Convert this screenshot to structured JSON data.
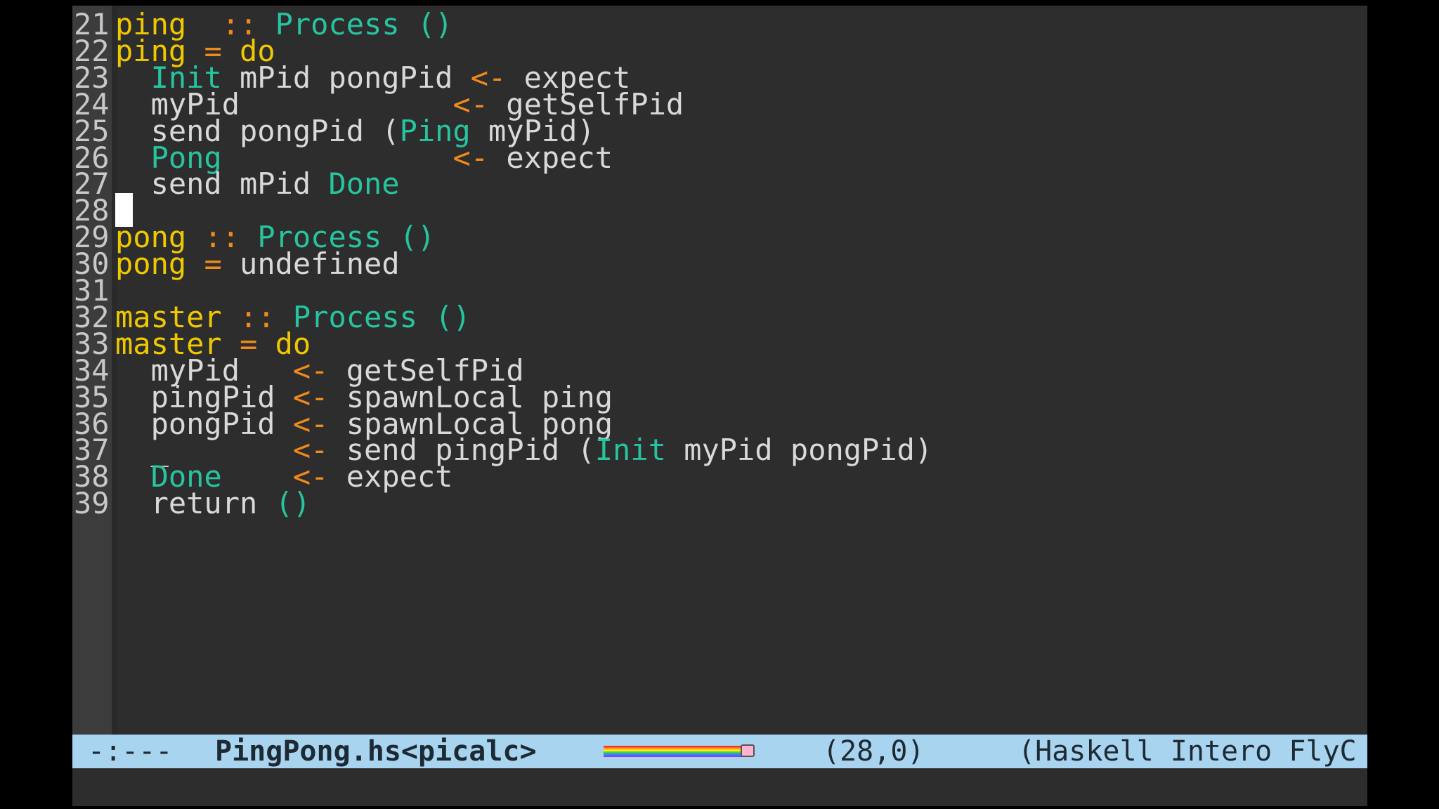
{
  "editor": {
    "lines": [
      {
        "num": "21",
        "segs": [
          [
            "kw",
            "ping"
          ],
          [
            "",
            "  "
          ],
          [
            "op",
            "::"
          ],
          [
            "",
            ""
          ],
          [
            "",
            ""
          ],
          [
            "ty",
            " Process ()"
          ]
        ]
      },
      {
        "num": "22",
        "segs": [
          [
            "kw",
            "ping"
          ],
          [
            "",
            " "
          ],
          [
            "op",
            "="
          ],
          [
            "",
            " "
          ],
          [
            "kw",
            "do"
          ]
        ]
      },
      {
        "num": "23",
        "segs": [
          [
            "",
            "  "
          ],
          [
            "ty",
            "Init"
          ],
          [
            "",
            " mPid pongPid "
          ],
          [
            "op",
            "<-"
          ],
          [
            "",
            " expect"
          ]
        ]
      },
      {
        "num": "24",
        "segs": [
          [
            "",
            "  myPid            "
          ],
          [
            "op",
            "<-"
          ],
          [
            "",
            " getSelfPid"
          ]
        ]
      },
      {
        "num": "25",
        "segs": [
          [
            "",
            "  send pongPid ("
          ],
          [
            "ty",
            "Ping"
          ],
          [
            "",
            " myPid)"
          ]
        ]
      },
      {
        "num": "26",
        "segs": [
          [
            "",
            "  "
          ],
          [
            "ty",
            "Pong"
          ],
          [
            "",
            "             "
          ],
          [
            "op",
            "<-"
          ],
          [
            "",
            " expect"
          ]
        ]
      },
      {
        "num": "27",
        "segs": [
          [
            "",
            "  send mPid "
          ],
          [
            "ty",
            "Done"
          ]
        ]
      },
      {
        "num": "28",
        "segs": [],
        "cursor": true
      },
      {
        "num": "29",
        "segs": [
          [
            "kw",
            "pong"
          ],
          [
            "",
            " "
          ],
          [
            "op",
            "::"
          ],
          [
            "",
            " "
          ],
          [
            "ty",
            "Process ()"
          ]
        ]
      },
      {
        "num": "30",
        "segs": [
          [
            "kw",
            "pong"
          ],
          [
            "",
            " "
          ],
          [
            "op",
            "="
          ],
          [
            "",
            " undefined"
          ]
        ]
      },
      {
        "num": "31",
        "segs": []
      },
      {
        "num": "32",
        "segs": [
          [
            "kw",
            "master"
          ],
          [
            "",
            " "
          ],
          [
            "op",
            "::"
          ],
          [
            "",
            " "
          ],
          [
            "ty",
            "Process ()"
          ]
        ]
      },
      {
        "num": "33",
        "segs": [
          [
            "kw",
            "master"
          ],
          [
            "",
            " "
          ],
          [
            "op",
            "="
          ],
          [
            "",
            " "
          ],
          [
            "kw",
            "do"
          ]
        ]
      },
      {
        "num": "34",
        "segs": [
          [
            "",
            "  myPid   "
          ],
          [
            "op",
            "<-"
          ],
          [
            "",
            " getSelfPid"
          ]
        ]
      },
      {
        "num": "35",
        "segs": [
          [
            "",
            "  pingPid "
          ],
          [
            "op",
            "<-"
          ],
          [
            "",
            " spawnLocal ping"
          ]
        ]
      },
      {
        "num": "36",
        "segs": [
          [
            "",
            "  pongPid "
          ],
          [
            "op",
            "<-"
          ],
          [
            "",
            " spawnLocal pong"
          ]
        ]
      },
      {
        "num": "37",
        "segs": [
          [
            "",
            "  _       "
          ],
          [
            "op",
            "<-"
          ],
          [
            "",
            " send pingPid ("
          ],
          [
            "ty",
            "Init"
          ],
          [
            "",
            " myPid pongPid)"
          ]
        ]
      },
      {
        "num": "38",
        "segs": [
          [
            "",
            "  "
          ],
          [
            "ty",
            "Done"
          ],
          [
            "",
            "    "
          ],
          [
            "op",
            "<-"
          ],
          [
            "",
            " expect"
          ]
        ]
      },
      {
        "num": "39",
        "segs": [
          [
            "",
            "  return "
          ],
          [
            "ty",
            "()"
          ]
        ]
      }
    ]
  },
  "modeline": {
    "status": "-:---",
    "buffer": "PingPong.hs<picalc>",
    "position": "(28,0)",
    "modes": "(Haskell Intero FlyC"
  },
  "colors": {
    "background": "#2d2d2d",
    "gutter": "#3c3c3c",
    "function_name": "#f0c800",
    "operator": "#f08a1c",
    "constructor": "#27c4a0",
    "modeline": "#a8d4f0"
  }
}
